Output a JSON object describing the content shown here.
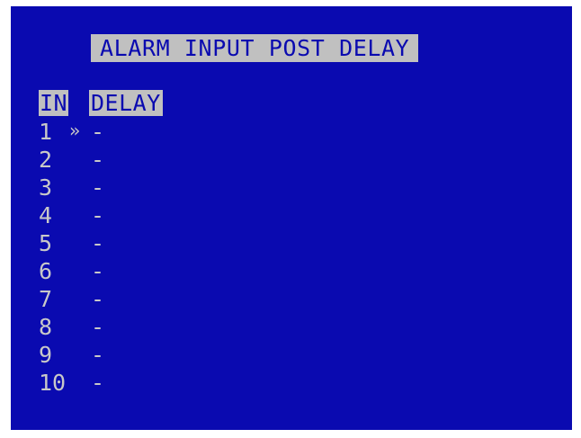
{
  "title": "ALARM INPUT POST DELAY",
  "columns": {
    "input": "IN",
    "delay": "DELAY"
  },
  "cursor_symbol": "»",
  "rows": [
    {
      "input": "1",
      "delay": "-"
    },
    {
      "input": "2",
      "delay": "-"
    },
    {
      "input": "3",
      "delay": "-"
    },
    {
      "input": "4",
      "delay": "-"
    },
    {
      "input": "5",
      "delay": "-"
    },
    {
      "input": "6",
      "delay": "-"
    },
    {
      "input": "7",
      "delay": "-"
    },
    {
      "input": "8",
      "delay": "-"
    },
    {
      "input": "9",
      "delay": "-"
    },
    {
      "input": "10",
      "delay": "-"
    }
  ],
  "colors": {
    "background": "#0a0ab0",
    "text": "#c8c8c8",
    "highlight": "#c0c0c0"
  }
}
